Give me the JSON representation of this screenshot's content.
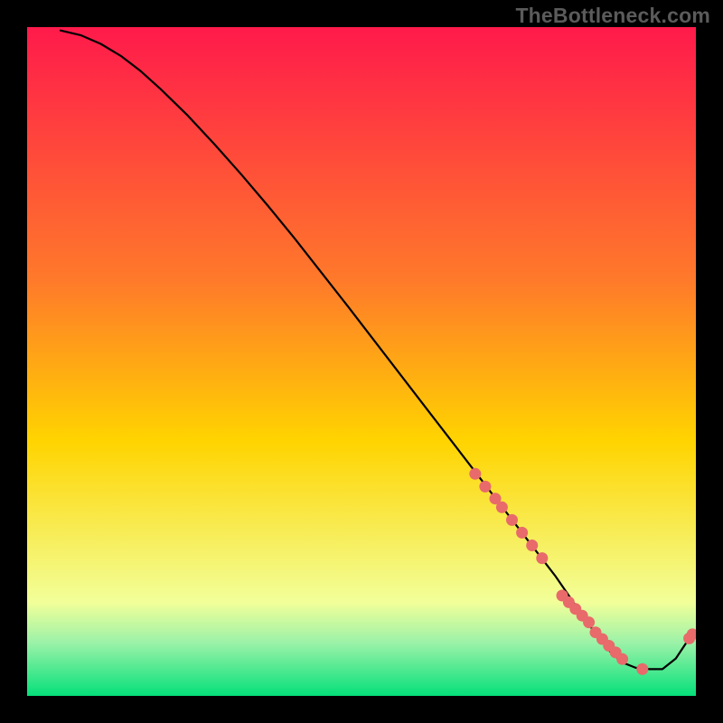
{
  "watermark": "TheBottleneck.com",
  "chart_data": {
    "type": "line",
    "title": "",
    "xlabel": "",
    "ylabel": "",
    "xlim": [
      0,
      100
    ],
    "ylim": [
      0,
      100
    ],
    "grid": false,
    "background_gradient": {
      "top_color": "#ff1a4b",
      "mid_color": "#ffd400",
      "low_color": "#f2ff99",
      "band1_color": "#9cf2a8",
      "bottom_color": "#05e07a"
    },
    "series": [
      {
        "name": "curve",
        "type": "line",
        "stroke": "#000000",
        "x": [
          5,
          8,
          11,
          14,
          17,
          20,
          24,
          28,
          32,
          36,
          40,
          44,
          48,
          52,
          56,
          60,
          64,
          67,
          70,
          73,
          76,
          79,
          81,
          83,
          85,
          87,
          89,
          91,
          93,
          95,
          97,
          99
        ],
        "y": [
          99.5,
          98.8,
          97.5,
          95.7,
          93.4,
          90.7,
          86.8,
          82.5,
          78.0,
          73.3,
          68.4,
          63.3,
          58.2,
          53.0,
          47.8,
          42.6,
          37.4,
          33.5,
          29.6,
          25.7,
          21.8,
          17.9,
          15.0,
          12.1,
          9.3,
          6.8,
          5.0,
          4.2,
          4.0,
          4.0,
          5.6,
          8.6
        ]
      },
      {
        "name": "markers",
        "type": "scatter",
        "fill": "#e86a6a",
        "x": [
          67,
          68.5,
          70,
          71,
          72.5,
          74,
          75.5,
          77,
          80,
          81,
          82,
          83,
          84,
          85,
          86,
          87,
          88,
          89,
          92,
          99,
          99.5
        ],
        "y": [
          33.2,
          31.3,
          29.5,
          28.2,
          26.3,
          24.4,
          22.5,
          20.6,
          15.0,
          14.0,
          13.0,
          12.0,
          11.0,
          9.5,
          8.5,
          7.5,
          6.5,
          5.5,
          4.0,
          8.6,
          9.2
        ]
      }
    ]
  }
}
